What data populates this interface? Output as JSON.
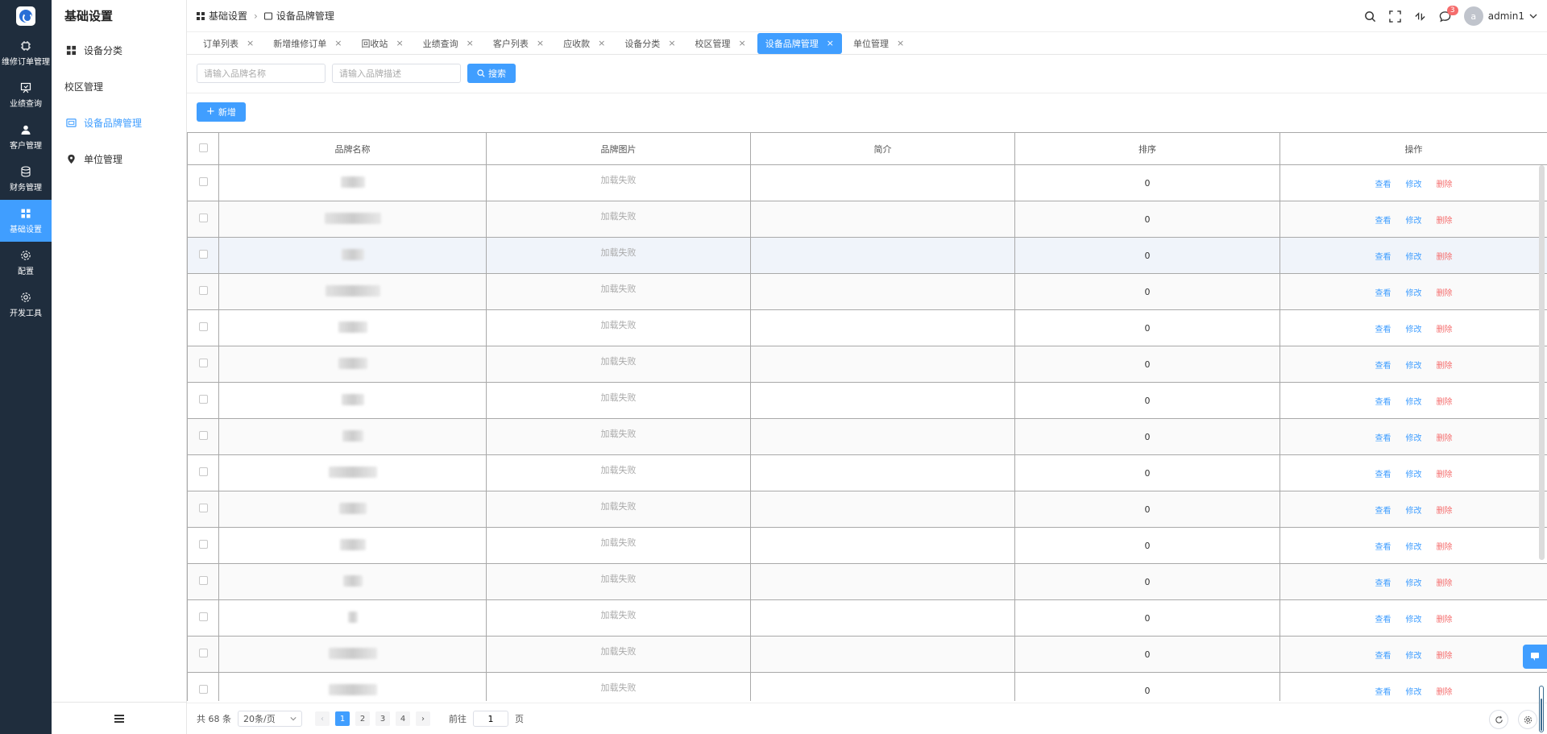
{
  "rail": {
    "items": [
      {
        "label": "维修订单管理",
        "icon": "chip-icon"
      },
      {
        "label": "业绩查询",
        "icon": "easel-icon"
      },
      {
        "label": "客户管理",
        "icon": "user-icon"
      },
      {
        "label": "财务管理",
        "icon": "database-icon"
      },
      {
        "label": "基础设置",
        "icon": "grid-icon"
      },
      {
        "label": "配置",
        "icon": "gear-icon"
      },
      {
        "label": "开发工具",
        "icon": "gear-icon"
      }
    ],
    "active_index": 4
  },
  "subnav": {
    "title": "基础设置",
    "items": [
      {
        "label": "设备分类"
      },
      {
        "label": "校区管理"
      },
      {
        "label": "设备品牌管理"
      },
      {
        "label": "单位管理"
      }
    ]
  },
  "breadcrumb": {
    "root": "基础设置",
    "current": "设备品牌管理"
  },
  "header": {
    "notification_count": "3",
    "avatar_letter": "a",
    "username": "admin1"
  },
  "tabs": [
    {
      "label": "订单列表"
    },
    {
      "label": "新增维修订单"
    },
    {
      "label": "回收站"
    },
    {
      "label": "业绩查询"
    },
    {
      "label": "客户列表"
    },
    {
      "label": "应收款"
    },
    {
      "label": "设备分类"
    },
    {
      "label": "校区管理"
    },
    {
      "label": "设备品牌管理"
    },
    {
      "label": "单位管理"
    }
  ],
  "active_tab": 8,
  "search": {
    "name_placeholder": "请输入品牌名称",
    "desc_placeholder": "请输入品牌描述",
    "search_label": "搜索"
  },
  "toolbar": {
    "add_label": "新增"
  },
  "table": {
    "columns": [
      "品牌名称",
      "品牌图片",
      "简介",
      "排序",
      "操作"
    ],
    "image_fail_text": "加载失败",
    "actions": {
      "view": "查看",
      "edit": "修改",
      "delete": "删除"
    },
    "rows": [
      {
        "sort": "0"
      },
      {
        "sort": "0"
      },
      {
        "sort": "0"
      },
      {
        "sort": "0"
      },
      {
        "sort": "0"
      },
      {
        "sort": "0"
      },
      {
        "sort": "0"
      },
      {
        "sort": "0"
      },
      {
        "sort": "0"
      },
      {
        "sort": "0"
      },
      {
        "sort": "0"
      },
      {
        "sort": "0"
      },
      {
        "sort": "0"
      },
      {
        "sort": "0"
      },
      {
        "sort": "0"
      }
    ]
  },
  "pagination": {
    "total_text": "共 68 条",
    "page_size": "20条/页",
    "pages": [
      "1",
      "2",
      "3",
      "4"
    ],
    "current_page": "1",
    "goto_prefix": "前往",
    "goto_value": "1",
    "goto_suffix": "页"
  },
  "colors": {
    "primary": "#409eff",
    "danger": "#f56c6c",
    "rail_bg": "#1f2d3d"
  }
}
